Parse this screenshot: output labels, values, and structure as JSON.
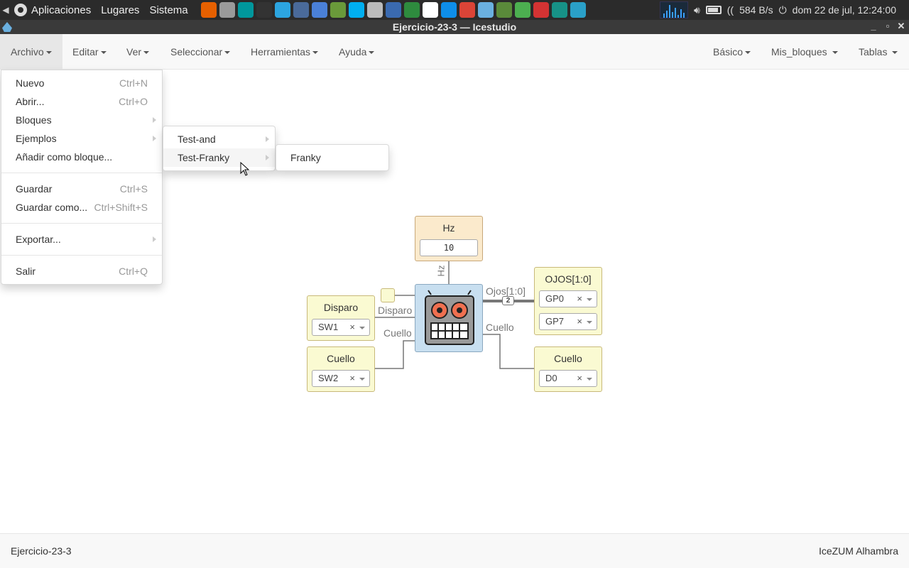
{
  "system_panel": {
    "menus": [
      "Aplicaciones",
      "Lugares",
      "Sistema"
    ],
    "launchers": [
      {
        "icon": "firefox-icon",
        "color": "#e66000"
      },
      {
        "icon": "drive-icon",
        "color": "#9a9a9a"
      },
      {
        "icon": "arduino-icon",
        "color": "#00979c"
      },
      {
        "icon": "terminal-icon",
        "color": "#333333"
      },
      {
        "icon": "telegram-icon",
        "color": "#2ca5e0"
      },
      {
        "icon": "monitor-icon",
        "color": "#4a6a9a"
      },
      {
        "icon": "chromium-icon",
        "color": "#4a80d8"
      },
      {
        "icon": "edit-icon",
        "color": "#6a9a3a"
      },
      {
        "icon": "skype-icon",
        "color": "#00aff0"
      },
      {
        "icon": "calculator-icon",
        "color": "#bbbbbb"
      },
      {
        "icon": "virtualbox-icon",
        "color": "#3a6ab0"
      },
      {
        "icon": "spreadsheet-icon",
        "color": "#2e8b3e"
      },
      {
        "icon": "play-icon",
        "color": "#ffffff"
      },
      {
        "icon": "teamviewer-icon",
        "color": "#0e8ee9"
      },
      {
        "icon": "chrome-icon",
        "color": "#db4437"
      },
      {
        "icon": "icestudio-icon",
        "color": "#6ab0e0"
      },
      {
        "icon": "minecraft-icon",
        "color": "#5a8a3a"
      },
      {
        "icon": "network-icon",
        "color": "#4caf50"
      },
      {
        "icon": "settings-icon",
        "color": "#d33333"
      },
      {
        "icon": "gitkraken-icon",
        "color": "#179287"
      },
      {
        "icon": "c-icon",
        "color": "#2aa0c8"
      }
    ],
    "net_speed": "584 B/s",
    "datetime": "dom 22 de jul, 12:24:00"
  },
  "window": {
    "title": "Ejercicio-23-3 — Icestudio",
    "buttons": [
      "_",
      "▫",
      "✕"
    ]
  },
  "navbar": {
    "left": [
      "Archivo",
      "Editar",
      "Ver",
      "Seleccionar",
      "Herramientas",
      "Ayuda"
    ],
    "right": [
      "Básico",
      "Mis_bloques",
      "Tablas"
    ]
  },
  "file_menu": {
    "items": [
      {
        "label": "Nuevo",
        "shortcut": "Ctrl+N"
      },
      {
        "label": "Abrir...",
        "shortcut": "Ctrl+O"
      },
      {
        "label": "Bloques",
        "shortcut": ""
      },
      {
        "label": "Ejemplos",
        "shortcut": ""
      },
      {
        "label": "Añadir como bloque...",
        "shortcut": ""
      },
      {
        "label": "Guardar",
        "shortcut": "Ctrl+S"
      },
      {
        "label": "Guardar como...",
        "shortcut": "Ctrl+Shift+S"
      },
      {
        "label": "Exportar...",
        "shortcut": ""
      },
      {
        "label": "Salir",
        "shortcut": "Ctrl+Q"
      }
    ]
  },
  "examples_submenu": {
    "items": [
      "Test-and",
      "Test-Franky"
    ]
  },
  "franky_submenu": {
    "items": [
      "Franky"
    ]
  },
  "diagram": {
    "hz_block": {
      "title": "Hz",
      "value": "10"
    },
    "disparo_in": {
      "title": "Disparo",
      "pin": "SW1"
    },
    "cuello_in": {
      "title": "Cuello",
      "pin": "SW2"
    },
    "ojos_out": {
      "title": "OJOS[1:0]",
      "pins": [
        "GP0",
        "GP7"
      ]
    },
    "cuello_out": {
      "title": "Cuello",
      "pin": "D0"
    },
    "wire_labels": {
      "hz": "Hz",
      "disparo": "Disparo",
      "cuello_in": "Cuello",
      "ojos": "Ojos[1:0]",
      "ojos_width": "2",
      "cuello_out": "Cuello"
    },
    "clear_symbol": "×"
  },
  "footer": {
    "project": "Ejercicio-23-3",
    "board": "IceZUM Alhambra"
  }
}
